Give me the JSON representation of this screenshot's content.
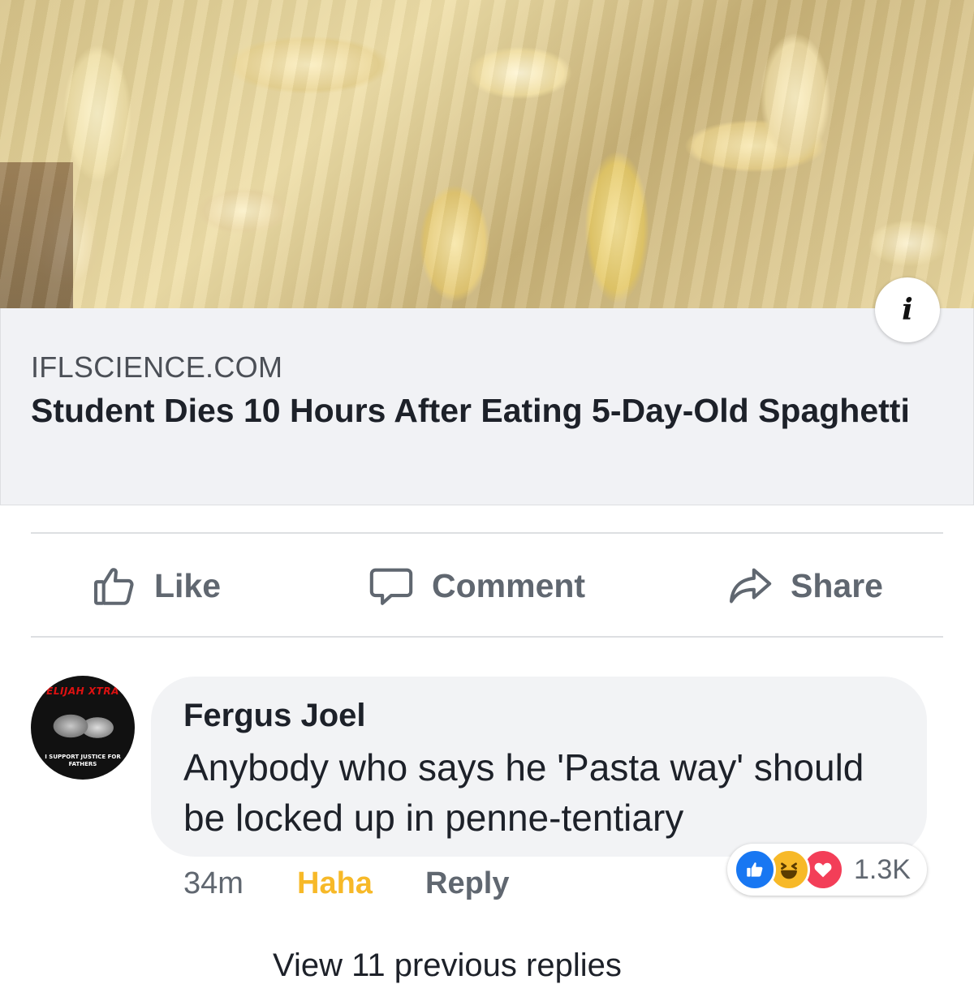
{
  "link_preview": {
    "domain": "IFLSCIENCE.COM",
    "title": "Student Dies 10 Hours After Eating 5-Day-Old Spaghetti",
    "info_icon": "info-icon"
  },
  "actions": {
    "like_label": "Like",
    "comment_label": "Comment",
    "share_label": "Share"
  },
  "comment": {
    "author": "Fergus Joel",
    "text": "Anybody who says he 'Pasta way' should be locked up in penne-tentiary",
    "time": "34m",
    "reaction_label": "Haha",
    "reply_label": "Reply",
    "avatar": {
      "top_text": "ELIJAH XTRA",
      "bottom_text": "I SUPPORT JUSTICE FOR FATHERS"
    },
    "reactions": {
      "icons": [
        "like-reaction-icon",
        "haha-reaction-icon",
        "love-reaction-icon"
      ],
      "count": "1.3K"
    }
  },
  "thread": {
    "view_replies_label": "View 11 previous replies"
  },
  "colors": {
    "like_blue": "#1877f2",
    "haha_yellow": "#f7b928",
    "love_red": "#f33e58",
    "secondary_text": "#606770"
  }
}
